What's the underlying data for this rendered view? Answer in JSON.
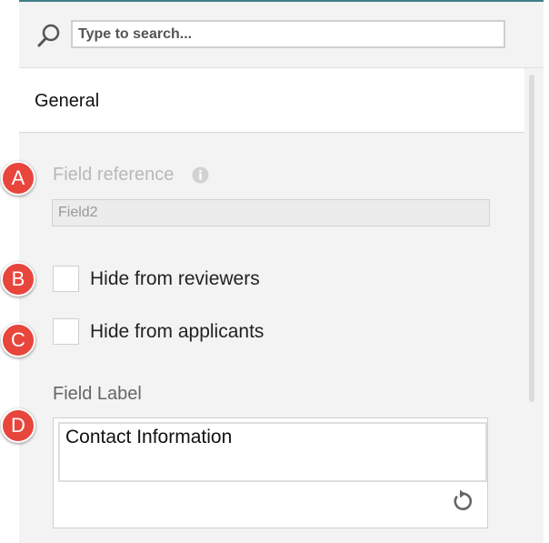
{
  "search": {
    "placeholder": "Type to search...",
    "icon": "search-icon"
  },
  "section": {
    "title": "General"
  },
  "field_reference": {
    "label": "Field reference",
    "value": "Field2",
    "icon": "info-icon"
  },
  "options": [
    {
      "label": "Hide from reviewers",
      "checked": false
    },
    {
      "label": "Hide from applicants",
      "checked": false
    }
  ],
  "field_label": {
    "title": "Field Label",
    "value": "Contact Information",
    "reset_icon": "reset-icon"
  },
  "markers": [
    "A",
    "B",
    "C",
    "D"
  ],
  "colors": {
    "accent": "#3f7f87",
    "marker": "#e8453c",
    "panel_bg": "#f3f3f3"
  }
}
